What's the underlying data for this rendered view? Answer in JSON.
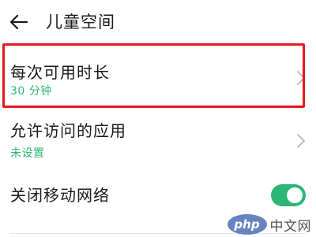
{
  "header": {
    "title": "儿童空间"
  },
  "settings": [
    {
      "label": "每次可用时长",
      "value": "30 分钟"
    },
    {
      "label": "允许访问的应用",
      "value": "未设置"
    },
    {
      "label": "关闭移动网络",
      "enabled": true
    }
  ],
  "colors": {
    "accent": "#2bb673",
    "highlight_border": "#e5191e"
  },
  "watermark": {
    "logo": "php",
    "text": "中文网"
  }
}
